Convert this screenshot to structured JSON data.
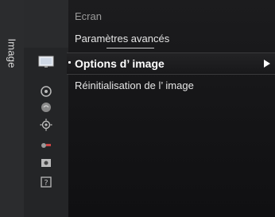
{
  "sidebar": {
    "label": "Image"
  },
  "menu": {
    "items": [
      {
        "label": "Ecran"
      },
      {
        "label": "Paramètres avancés"
      },
      {
        "label": "Options d’ image"
      },
      {
        "label": "Réinitialisation de l’ image"
      }
    ],
    "selected_index": 2
  },
  "icons": [
    "picture-icon",
    "sound-icon",
    "channel-icon",
    "setup-icon",
    "input-icon",
    "application-icon",
    "support-icon"
  ],
  "colors": {
    "background": "#141416",
    "highlight_text": "#ffffff",
    "menu_text": "#e6e6e6",
    "dim_text": "#9a9a9a"
  }
}
